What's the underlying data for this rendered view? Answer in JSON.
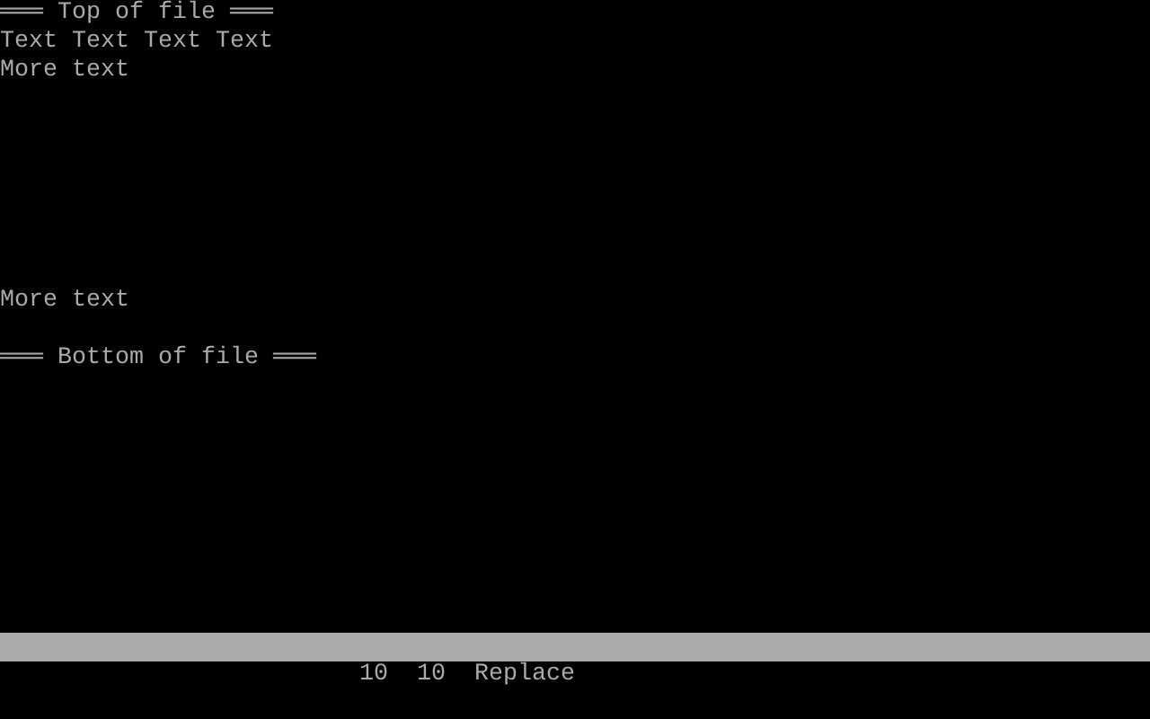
{
  "editor": {
    "top_marker": "═══ Top of file ═══",
    "blocks": [
      {
        "lines": [
          "Text Text Text Text",
          "More text"
        ]
      },
      {
        "lines": [
          "More text"
        ]
      }
    ],
    "bottom_marker": "═══ Bottom of file ═══"
  },
  "status_bar": {
    "line": "10",
    "column": "10",
    "mode": "Replace"
  }
}
